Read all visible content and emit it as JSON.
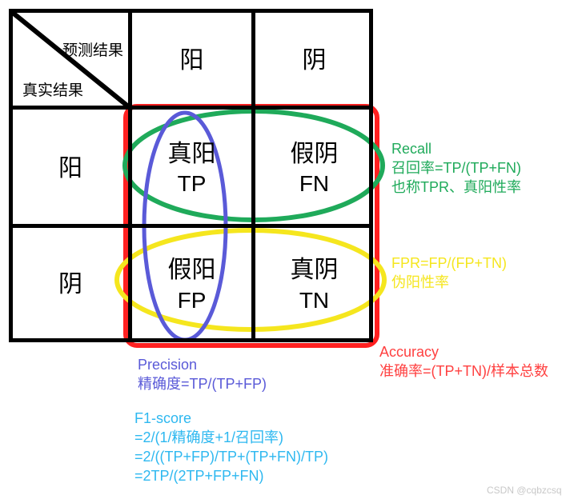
{
  "matrix": {
    "corner": {
      "predicted_label": "预测结果",
      "actual_label": "真实结果"
    },
    "column_headers": [
      "阳",
      "阴"
    ],
    "row_headers": [
      "阳",
      "阴"
    ],
    "cells": {
      "tp": {
        "zh": "真阳",
        "abbr": "TP"
      },
      "fn": {
        "zh": "假阴",
        "abbr": "FN"
      },
      "fp": {
        "zh": "假阳",
        "abbr": "FP"
      },
      "tn": {
        "zh": "真阴",
        "abbr": "TN"
      }
    }
  },
  "annotations": {
    "recall": {
      "color": "#1faa5a",
      "line1": "Recall",
      "line2": "召回率=TP/(TP+FN)",
      "line3": "也称TPR、真阳性率"
    },
    "fpr": {
      "color": "#f5e61e",
      "line1": "FPR=FP/(FP+TN)",
      "line2": "伪阳性率"
    },
    "accuracy": {
      "color": "#ff4040",
      "line1": "Accuracy",
      "line2": "准确率=(TP+TN)/样本总数"
    },
    "precision": {
      "color": "#5a5ad8",
      "line1": "Precision",
      "line2": "精确度=TP/(TP+FP)"
    },
    "f1": {
      "color": "#2eb8f0",
      "line1": "F1-score",
      "line2": "=2/(1/精确度+1/召回率)",
      "line3": "=2/((TP+FP)/TP+(TP+FN)/TP)",
      "line4": "=2TP/(2TP+FP+FN)"
    }
  },
  "highlights": {
    "recall_ellipse_color": "#1faa5a",
    "precision_ellipse_color": "#5a5ad8",
    "fpr_ellipse_color": "#f5e61e",
    "accuracy_rect_color": "#ff2020"
  },
  "watermark": "CSDN @cqbzcsq"
}
